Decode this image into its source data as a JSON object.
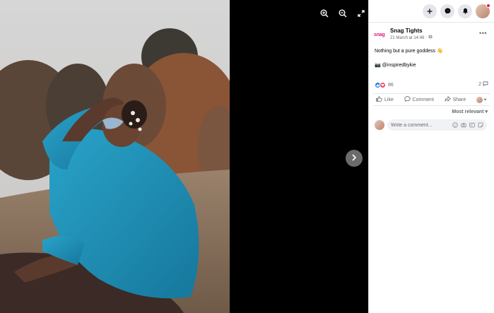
{
  "viewer": {
    "tools": [
      {
        "icon": "zoom-in-icon"
      },
      {
        "icon": "zoom-out-icon"
      },
      {
        "icon": "fullscreen-icon"
      }
    ],
    "next_icon": "chevron-right-icon"
  },
  "topbar": {
    "buttons": [
      "plus-icon",
      "messenger-icon",
      "notifications-icon"
    ],
    "notification_dot_color": "#e41e3f"
  },
  "post": {
    "page_logo": "snag",
    "page_name": "Snag Tights",
    "date": "21 March at 14:48 ·",
    "caption_line1": "Nothing but a pure goddess 👋",
    "caption_line2": "📷 @inspiredbykie",
    "reactions_count": "86",
    "comments_count": "2",
    "more_label": "•••"
  },
  "actions": {
    "like": "Like",
    "comment": "Comment",
    "share": "Share"
  },
  "sort_label": "Most relevant ▾",
  "comment_input": {
    "placeholder": "Write a comment..."
  },
  "colors": {
    "brand_blue": "#1877f2",
    "love_red": "#f33e58",
    "snag_pink": "#e2187a",
    "shirt_blue": "#1f8fb8"
  }
}
